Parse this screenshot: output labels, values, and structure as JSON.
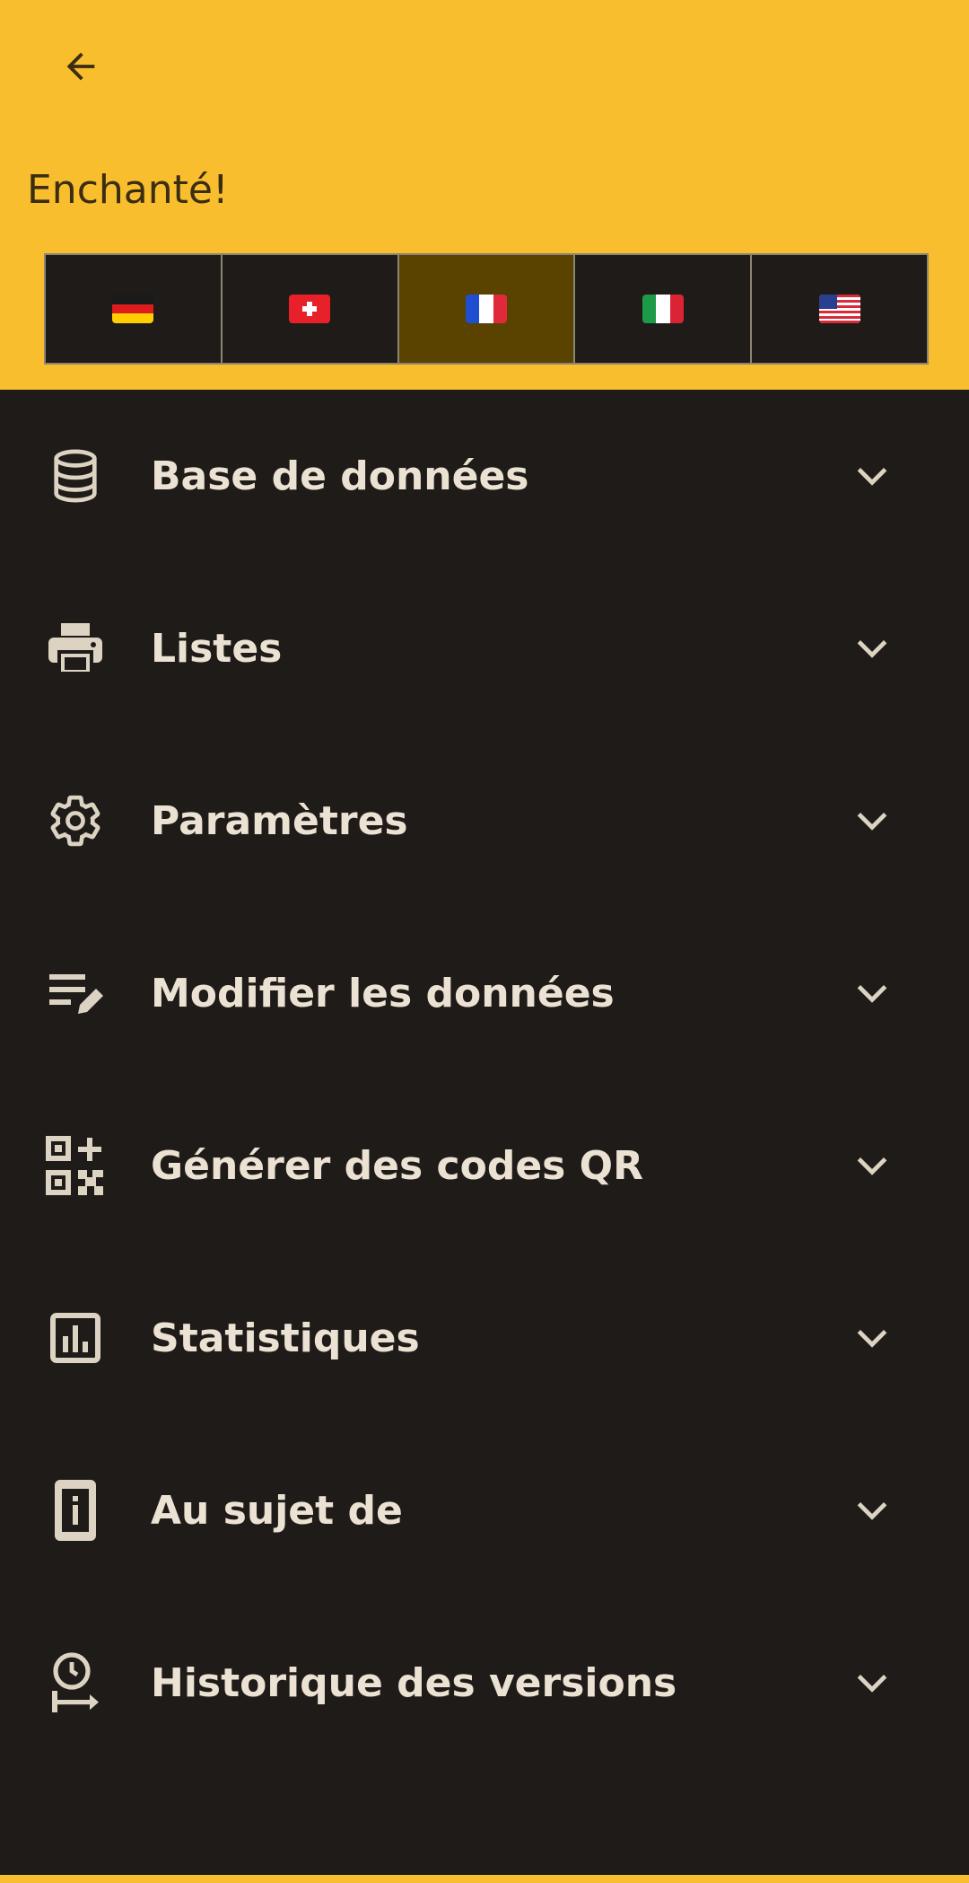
{
  "header": {
    "greeting": "Enchanté!",
    "back_icon": "arrow-back-icon",
    "languages": [
      {
        "name": "de-flag",
        "selected": false
      },
      {
        "name": "ch-flag",
        "selected": false
      },
      {
        "name": "fr-flag",
        "selected": true
      },
      {
        "name": "it-flag",
        "selected": false
      },
      {
        "name": "us-flag",
        "selected": false
      }
    ]
  },
  "menu": {
    "items": [
      {
        "label": "Base de données",
        "icon": "database-icon"
      },
      {
        "label": "Listes",
        "icon": "printer-icon"
      },
      {
        "label": "Paramètres",
        "icon": "gear-icon"
      },
      {
        "label": "Modifier les données",
        "icon": "edit-list-icon"
      },
      {
        "label": "Générer des codes QR",
        "icon": "qr-code-icon"
      },
      {
        "label": "Statistiques",
        "icon": "bar-chart-icon"
      },
      {
        "label": "Au sujet de",
        "icon": "info-icon"
      },
      {
        "label": "Historique des versions",
        "icon": "history-icon"
      }
    ]
  },
  "colors": {
    "accent": "#f8be2e",
    "background": "#1e1b18",
    "text": "#ece2d3",
    "selected_language": "#5a4300"
  }
}
